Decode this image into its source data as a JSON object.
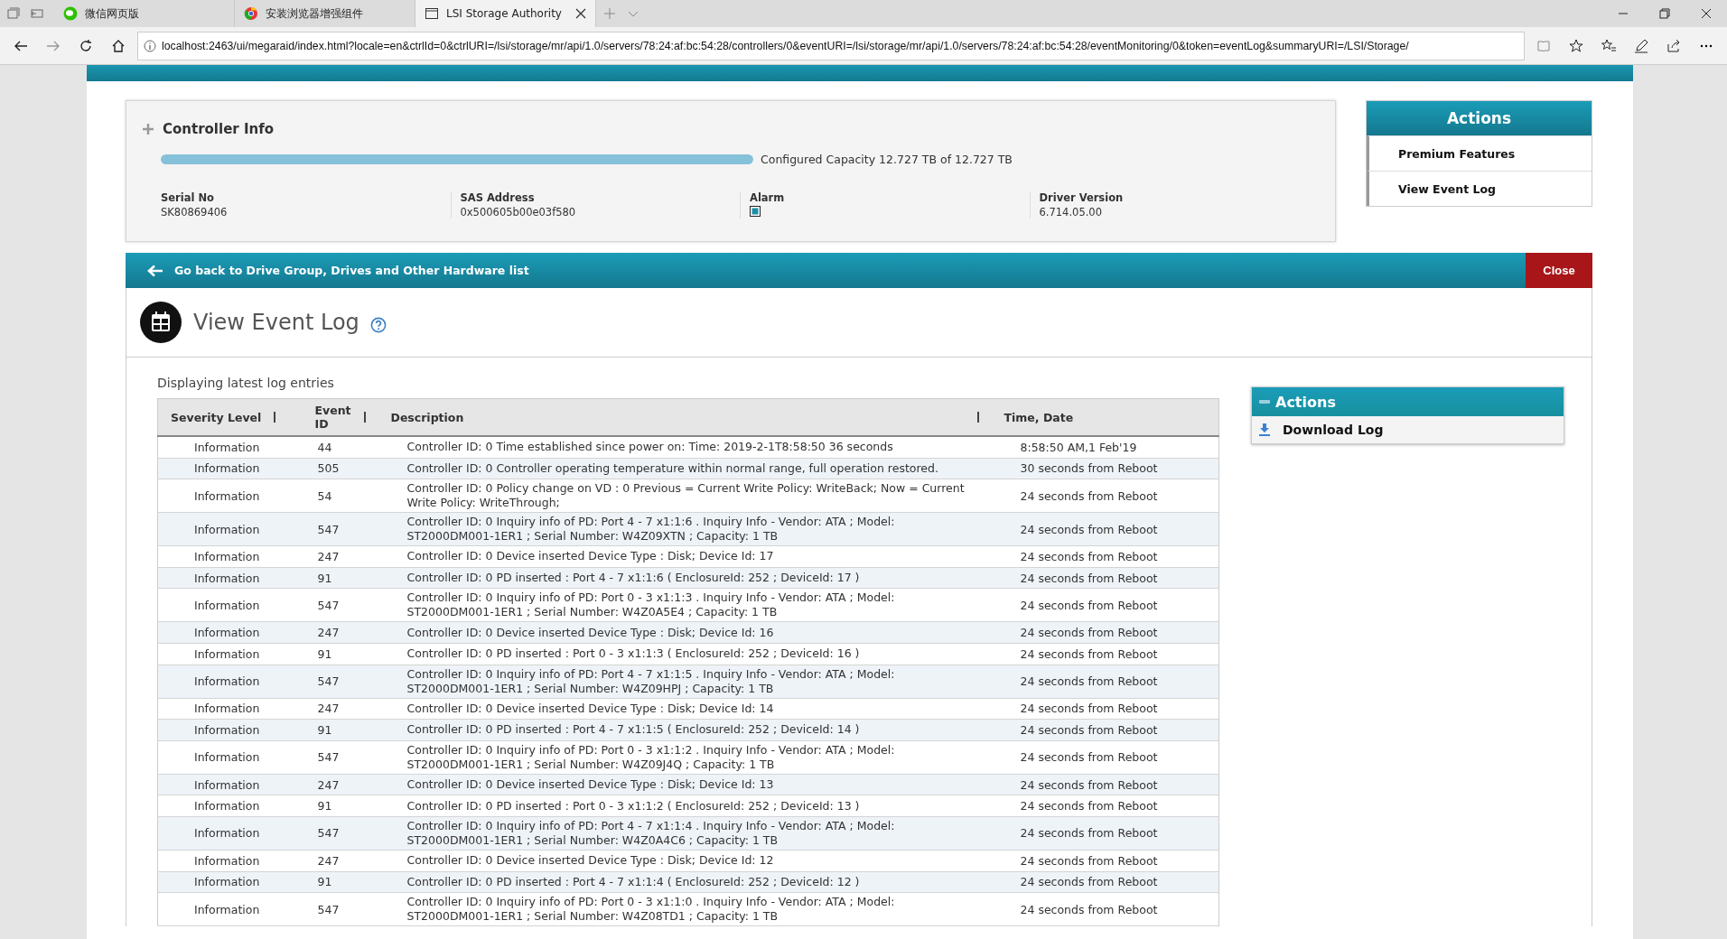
{
  "browser": {
    "tabs": [
      {
        "title": "微信网页版",
        "kind": "chat",
        "selected": false
      },
      {
        "title": "安装浏览器增强组件",
        "kind": "browser",
        "selected": false
      },
      {
        "title": "LSI Storage Authority",
        "kind": "page",
        "selected": true
      }
    ],
    "url": "localhost:2463/ui/megaraid/index.html?locale=en&ctrlId=0&ctrlURI=/lsi/storage/mr/api/1.0/servers/78:24:af:bc:54:28/controllers/0&eventURI=/lsi/storage/mr/api/1.0/servers/78:24:af:bc:54:28/eventMonitoring/0&token=eventLog&summaryURI=/LSI/Storage/"
  },
  "controller_info": {
    "title": "Controller Info",
    "level": 1.0,
    "capacity": "Configured Capacity 12.727 TB of 12.727 TB",
    "fields": [
      {
        "kind": "text",
        "label": "Serial No",
        "value": "SK80869406"
      },
      {
        "kind": "text",
        "label": "SAS Address",
        "value": "0x500605b00e03f580"
      },
      {
        "kind": "checkbox",
        "label": "Alarm",
        "checked": true
      },
      {
        "kind": "text",
        "label": "Driver Version",
        "value": "6.714.05.00"
      }
    ]
  },
  "actions": {
    "title": "Actions",
    "items": [
      {
        "label": "Premium Features"
      },
      {
        "label": "View Event Log"
      }
    ]
  },
  "back_bar": {
    "label": "Go back to Drive Group, Drives and Other Hardware list",
    "close": "Close"
  },
  "event_log": {
    "title": "View Event Log",
    "subtitle": "Displaying latest log entries",
    "columns": [
      "Severity Level",
      "Event ID",
      "Description",
      "Time, Date"
    ],
    "rows": [
      {
        "severity": "Information",
        "id": "44",
        "description": "Controller ID: 0 Time established since power on: Time: 2019-2-1T8:58:50 36 seconds",
        "time": "8:58:50 AM,1 Feb'19"
      },
      {
        "severity": "Information",
        "id": "505",
        "description": "Controller ID: 0 Controller operating temperature within normal range, full operation restored.",
        "time": "30 seconds from Reboot"
      },
      {
        "severity": "Information",
        "id": "54",
        "description": "Controller ID: 0 Policy change on VD : 0 Previous = Current Write Policy: WriteBack; Now = Current Write Policy: WriteThrough;",
        "time": "24 seconds from Reboot"
      },
      {
        "severity": "Information",
        "id": "547",
        "description": "Controller ID: 0 Inquiry info of PD: Port 4 - 7 x1:1:6 . Inquiry Info - Vendor: ATA ; Model: ST2000DM001-1ER1 ; Serial Number: W4Z09XTN ; Capacity: 1 TB",
        "time": "24 seconds from Reboot"
      },
      {
        "severity": "Information",
        "id": "247",
        "description": "Controller ID: 0 Device inserted Device Type : Disk; Device Id: 17",
        "time": "24 seconds from Reboot"
      },
      {
        "severity": "Information",
        "id": "91",
        "description": "Controller ID: 0 PD inserted : Port 4 - 7 x1:1:6 ( EnclosureId: 252 ; DeviceId: 17 )",
        "time": "24 seconds from Reboot"
      },
      {
        "severity": "Information",
        "id": "547",
        "description": "Controller ID: 0 Inquiry info of PD: Port 0 - 3 x1:1:3 . Inquiry Info - Vendor: ATA ; Model: ST2000DM001-1ER1 ; Serial Number: W4Z0A5E4 ; Capacity: 1 TB",
        "time": "24 seconds from Reboot"
      },
      {
        "severity": "Information",
        "id": "247",
        "description": "Controller ID: 0 Device inserted Device Type : Disk; Device Id: 16",
        "time": "24 seconds from Reboot"
      },
      {
        "severity": "Information",
        "id": "91",
        "description": "Controller ID: 0 PD inserted : Port 0 - 3 x1:1:3 ( EnclosureId: 252 ; DeviceId: 16 )",
        "time": "24 seconds from Reboot"
      },
      {
        "severity": "Information",
        "id": "547",
        "description": "Controller ID: 0 Inquiry info of PD: Port 4 - 7 x1:1:5 . Inquiry Info - Vendor: ATA ; Model: ST2000DM001-1ER1 ; Serial Number: W4Z09HPJ ; Capacity: 1 TB",
        "time": "24 seconds from Reboot"
      },
      {
        "severity": "Information",
        "id": "247",
        "description": "Controller ID: 0 Device inserted Device Type : Disk; Device Id: 14",
        "time": "24 seconds from Reboot"
      },
      {
        "severity": "Information",
        "id": "91",
        "description": "Controller ID: 0 PD inserted : Port 4 - 7 x1:1:5 ( EnclosureId: 252 ; DeviceId: 14 )",
        "time": "24 seconds from Reboot"
      },
      {
        "severity": "Information",
        "id": "547",
        "description": "Controller ID: 0 Inquiry info of PD: Port 0 - 3 x1:1:2 . Inquiry Info - Vendor: ATA ; Model: ST2000DM001-1ER1 ; Serial Number: W4Z09J4Q ; Capacity: 1 TB",
        "time": "24 seconds from Reboot"
      },
      {
        "severity": "Information",
        "id": "247",
        "description": "Controller ID: 0 Device inserted Device Type : Disk; Device Id: 13",
        "time": "24 seconds from Reboot"
      },
      {
        "severity": "Information",
        "id": "91",
        "description": "Controller ID: 0 PD inserted : Port 0 - 3 x1:1:2 ( EnclosureId: 252 ; DeviceId: 13 )",
        "time": "24 seconds from Reboot"
      },
      {
        "severity": "Information",
        "id": "547",
        "description": "Controller ID: 0 Inquiry info of PD: Port 4 - 7 x1:1:4 . Inquiry Info - Vendor: ATA ; Model: ST2000DM001-1ER1 ; Serial Number: W4Z0A4C6 ; Capacity: 1 TB",
        "time": "24 seconds from Reboot"
      },
      {
        "severity": "Information",
        "id": "247",
        "description": "Controller ID: 0 Device inserted Device Type : Disk; Device Id: 12",
        "time": "24 seconds from Reboot"
      },
      {
        "severity": "Information",
        "id": "91",
        "description": "Controller ID: 0 PD inserted : Port 4 - 7 x1:1:4 ( EnclosureId: 252 ; DeviceId: 12 )",
        "time": "24 seconds from Reboot"
      },
      {
        "severity": "Information",
        "id": "547",
        "description": "Controller ID: 0 Inquiry info of PD: Port 0 - 3 x1:1:0 . Inquiry Info - Vendor: ATA ; Model: ST2000DM001-1ER1 ; Serial Number: W4Z08TD1 ; Capacity: 1 TB",
        "time": "24 seconds from Reboot"
      }
    ],
    "side_actions": {
      "title": "Actions",
      "items": [
        {
          "label": "Download Log"
        }
      ]
    }
  }
}
